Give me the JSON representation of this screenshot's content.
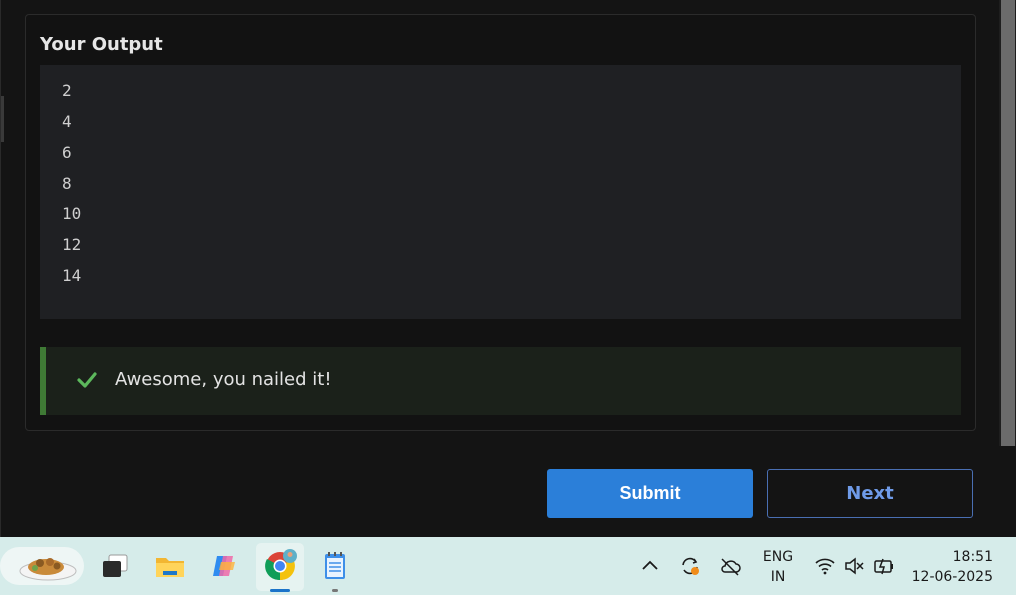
{
  "output": {
    "title": "Your Output",
    "lines": [
      "2",
      "4",
      "6",
      "8",
      "10",
      "12",
      "14"
    ]
  },
  "result": {
    "message": "Awesome, you nailed it!",
    "status_color": "#3f7a35"
  },
  "actions": {
    "submit_label": "Submit",
    "next_label": "Next"
  },
  "taskbar": {
    "apps": [
      "food-widget-icon",
      "task-view-icon",
      "file-explorer-icon",
      "copilot-icon",
      "chrome-icon",
      "notepad-icon"
    ],
    "tray": {
      "lang_top": "ENG",
      "lang_bottom": "IN",
      "time": "18:51",
      "date": "12-06-2025"
    }
  },
  "colors": {
    "accent": "#2b7fd9",
    "background": "#141414"
  }
}
